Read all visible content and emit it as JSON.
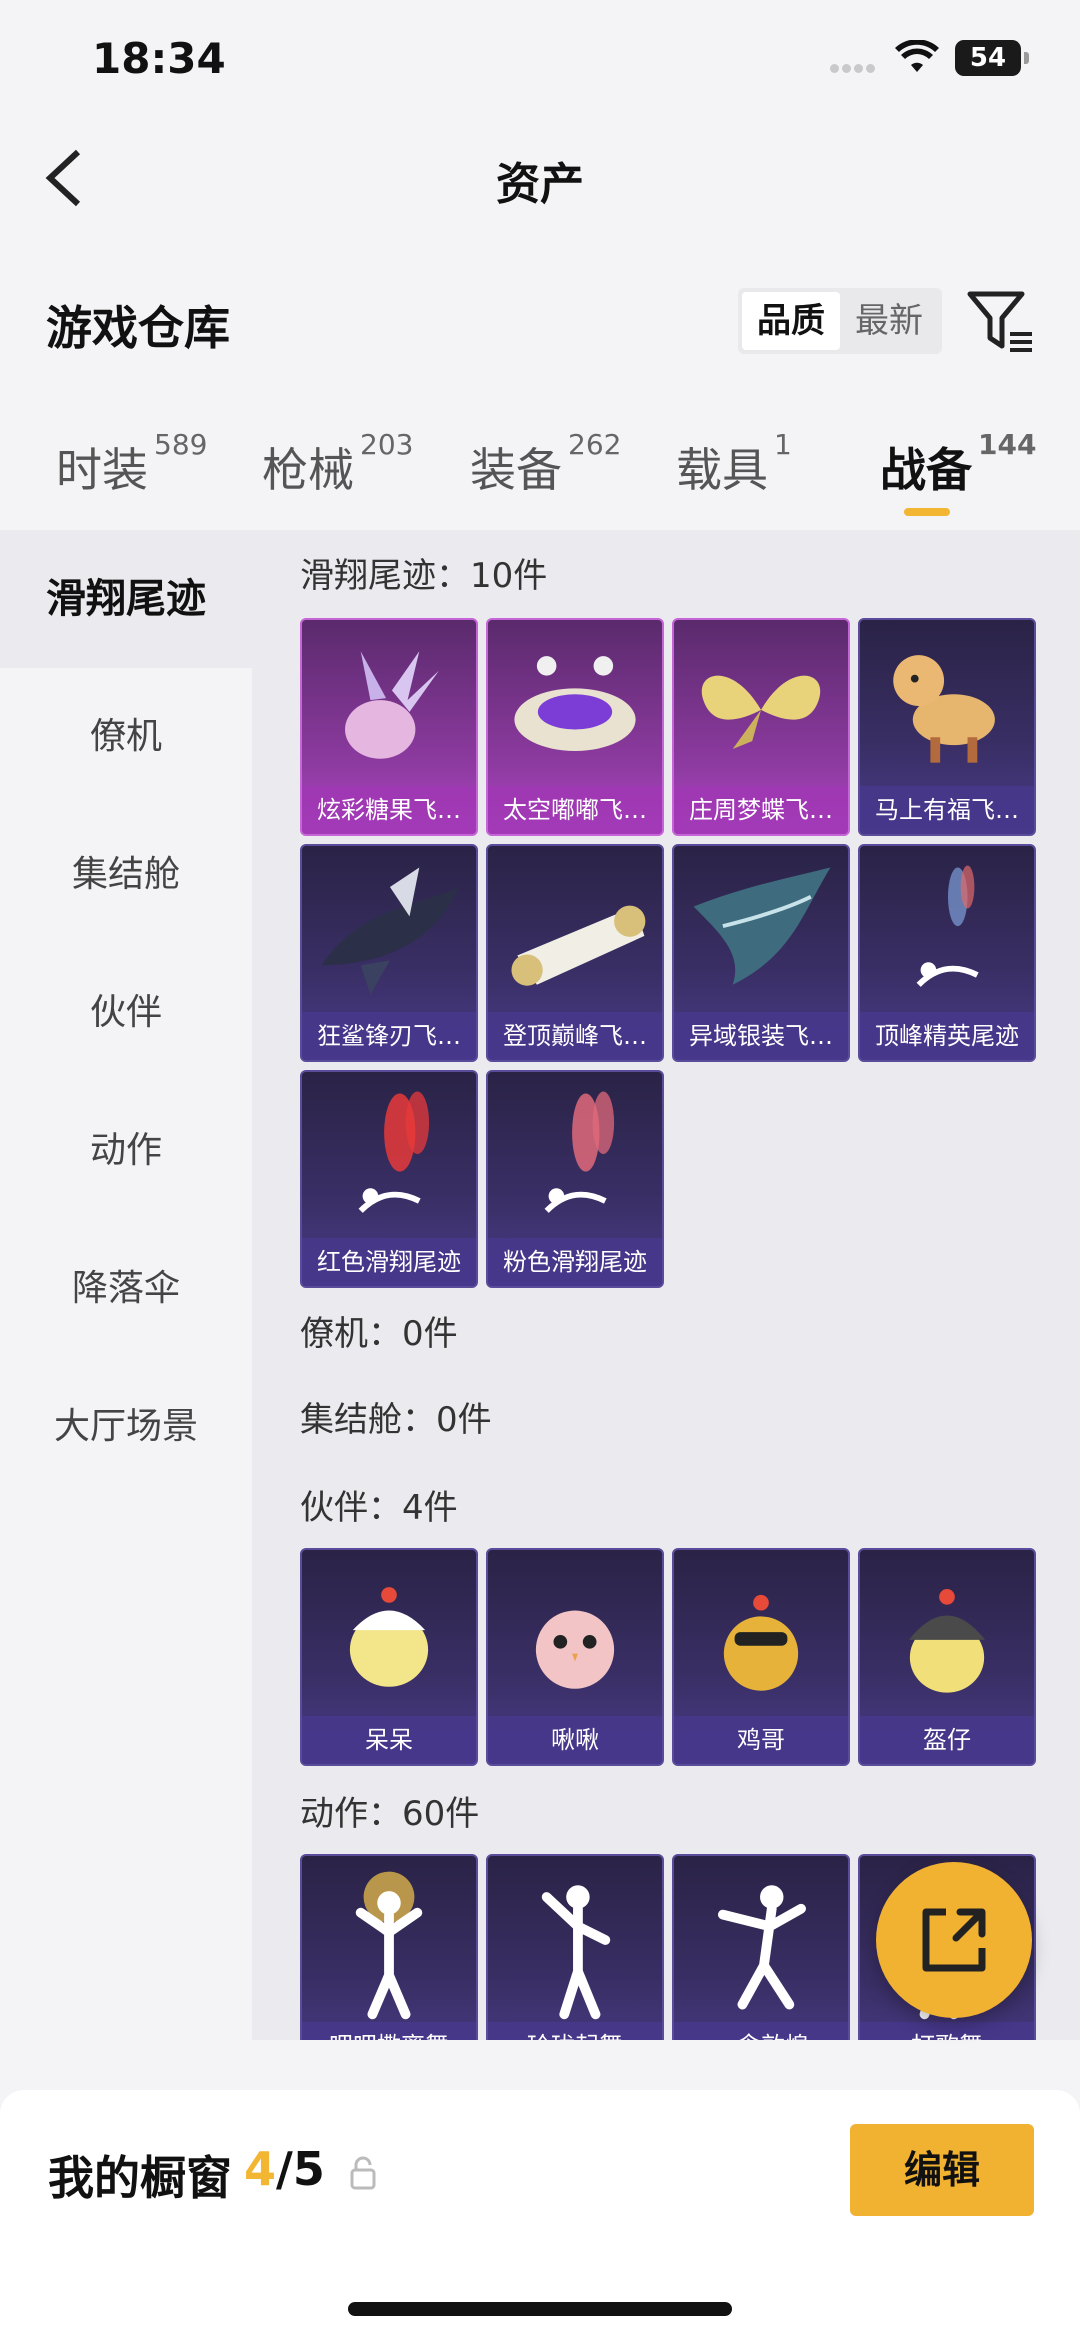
{
  "status_bar": {
    "time": "18:34",
    "battery": "54"
  },
  "nav": {
    "title": "资产"
  },
  "section": {
    "title": "游戏仓库",
    "sort_options": [
      "品质",
      "最新"
    ],
    "active_sort": "品质"
  },
  "tabs": [
    {
      "label": "时装",
      "count": "589"
    },
    {
      "label": "枪械",
      "count": "203"
    },
    {
      "label": "装备",
      "count": "262"
    },
    {
      "label": "载具",
      "count": "1"
    },
    {
      "label": "战备",
      "count": "144",
      "active": true
    }
  ],
  "sidebar": {
    "items": [
      "滑翔尾迹",
      "僚机",
      "集结舱",
      "伙伴",
      "动作",
      "降落伞",
      "大厅场景"
    ],
    "active": "滑翔尾迹"
  },
  "groups": [
    {
      "title": "滑翔尾迹：10件",
      "items": [
        "炫彩糖果飞…",
        "太空嘟嘟飞…",
        "庄周梦蝶飞…",
        "马上有福飞…",
        "狂鲨锋刃飞…",
        "登顶巅峰飞…",
        "异域银装飞…",
        "顶峰精英尾迹",
        "红色滑翔尾迹",
        "粉色滑翔尾迹"
      ]
    },
    {
      "title": "僚机：0件",
      "items": []
    },
    {
      "title": "集结舱：0件",
      "items": []
    },
    {
      "title": "伙伴：4件",
      "items": [
        "呆呆",
        "啾啾",
        "鸡哥",
        "盔仔"
      ]
    },
    {
      "title": "动作：60件",
      "items": [
        "呷呷撒离舞",
        "玲珑起舞",
        "一念敦煌",
        "打歌舞"
      ]
    }
  ],
  "bottom": {
    "title": "我的橱窗",
    "count_current": "4",
    "count_total": "/5",
    "edit_label": "编辑"
  },
  "colors": {
    "accent": "#f1b131",
    "card_purple": "#b546c9",
    "card_dark": "#3a2f66"
  }
}
